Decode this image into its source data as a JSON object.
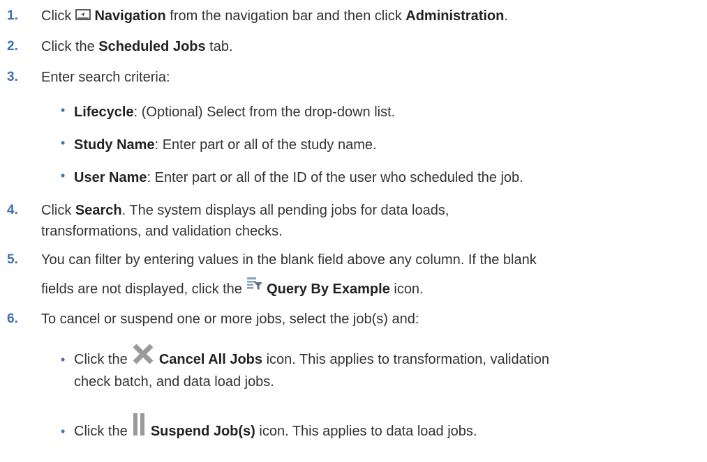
{
  "steps": [
    {
      "number": "1.",
      "pre": "Click",
      "icon": "navigation-icon",
      "bold1": "Navigation",
      "mid": " from the navigation bar and then click ",
      "bold2": "Administration",
      "post": "."
    },
    {
      "number": "2.",
      "pre": "Click the ",
      "bold1": "Scheduled Jobs",
      "post": " tab."
    },
    {
      "number": "3.",
      "text": "Enter search criteria:",
      "bullets": [
        {
          "term": "Lifecycle",
          "desc": ": (Optional) Select from the drop-down list."
        },
        {
          "term": "Study Name",
          "desc": ": Enter part or all of the study name."
        },
        {
          "term": "User Name",
          "desc": ": Enter part or all of the ID of the user who scheduled the job."
        }
      ]
    },
    {
      "number": "4.",
      "pre": "Click ",
      "bold1": "Search",
      "line1_post": ". The system displays all pending jobs for data loads,",
      "line2": "transformations, and validation checks."
    },
    {
      "number": "5.",
      "line1": "You can filter by entering values in the blank field above any column. If the blank",
      "line2_pre": "fields are not displayed, click the",
      "icon": "query-by-example-icon",
      "bold1": "Query By Example",
      "line2_post": " icon."
    },
    {
      "number": "6.",
      "text": "To cancel or suspend one or more jobs, select the job(s) and:",
      "bullets": [
        {
          "pre": "Click the",
          "icon": "cancel-all-jobs-icon",
          "term": "Cancel All Jobs",
          "line1_post": " icon. This applies to transformation, validation",
          "line2": "check batch, and data load jobs."
        },
        {
          "pre": "Click the",
          "icon": "suspend-jobs-icon",
          "term": "Suspend Job(s)",
          "line1_post": " icon. This applies to data load jobs."
        }
      ]
    }
  ],
  "colors": {
    "step_number": "#3f6fb5",
    "text": "#333333",
    "icon_gray": "#9a9a9a"
  }
}
